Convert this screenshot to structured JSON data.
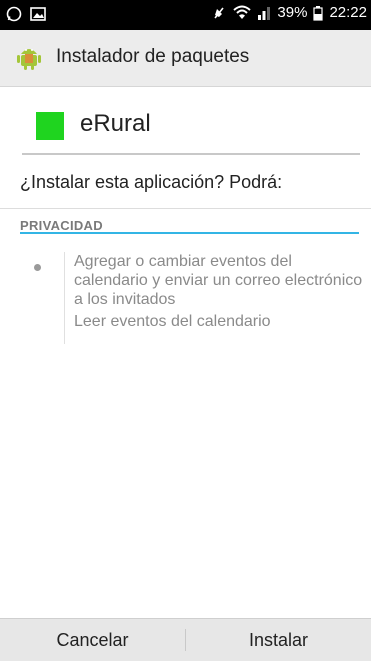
{
  "status_bar": {
    "battery": "39%",
    "time": "22:22",
    "icons": [
      "whatsapp-icon",
      "image-icon",
      "mute-icon",
      "wifi-icon",
      "signal-icon",
      "battery-icon"
    ]
  },
  "action_bar": {
    "title": "Instalador de paquetes",
    "icon": "android-icon"
  },
  "app": {
    "name": "eRural",
    "icon_color": "#1fd41f"
  },
  "install": {
    "question": "¿Instalar esta aplicación? Podrá:"
  },
  "section": {
    "title": "PRIVACIDAD",
    "accent_color": "#33b5e5"
  },
  "permissions": [
    "Agregar o cambiar eventos del\ncalendario y enviar un correo electrónico\na los invitados",
    "Leer eventos del calendario"
  ],
  "buttons": {
    "cancel": "Cancelar",
    "install": "Instalar"
  }
}
